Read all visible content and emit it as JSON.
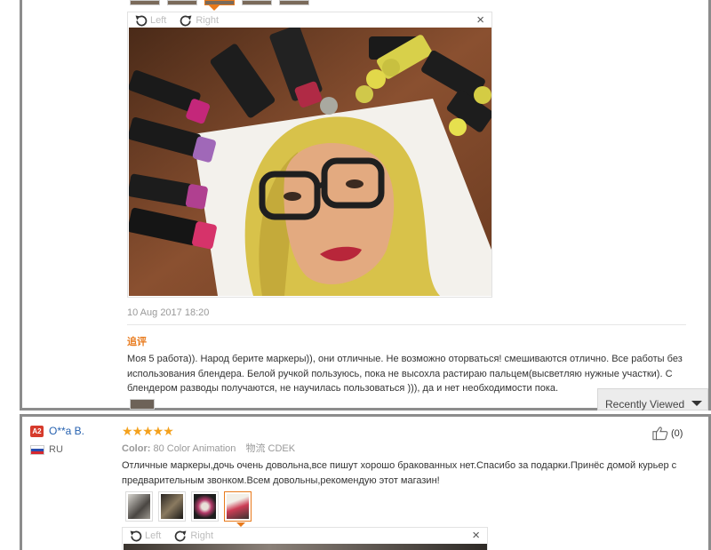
{
  "viewer_top": {
    "left_label": "Left",
    "right_label": "Right",
    "close_label": "×"
  },
  "review1": {
    "date": "10 Aug 2017 18:20",
    "followup_label": "追评",
    "followup_text": "Моя 5 работа)). Народ берите маркеры)), они отличные. Не возможно оторваться! смешиваются отлично. Все работы без использования блендера. Белой ручкой пользуюсь, пока не высохла растираю пальцем(высветляю нужные участки). С блендером разводы получаются, не научилась пользоваться ))), да и нет необходимости пока."
  },
  "recently_viewed": {
    "label": "Recently Viewed"
  },
  "review2": {
    "badge": "A2",
    "username": "O**a B.",
    "country": "RU",
    "stars": "★★★★★",
    "color_label": "Color:",
    "color_value": "80 Color Animation",
    "shipping_label": "物流",
    "shipping_value": "CDEK",
    "likes": "(0)",
    "text": "Отличные маркеры,дочь очень довольна,все пишут хорошо бракованных нет.Спасибо за подарки.Принёс домой курьер с предварительным звонком.Всем довольны,рекомендую этот магазин!"
  },
  "viewer_bottom": {
    "left_label": "Left",
    "right_label": "Right",
    "close_label": "×"
  },
  "colors": {
    "accent": "#e87a1c",
    "link": "#2762b0",
    "star": "#f4a11d",
    "badge": "#d63b2c"
  }
}
